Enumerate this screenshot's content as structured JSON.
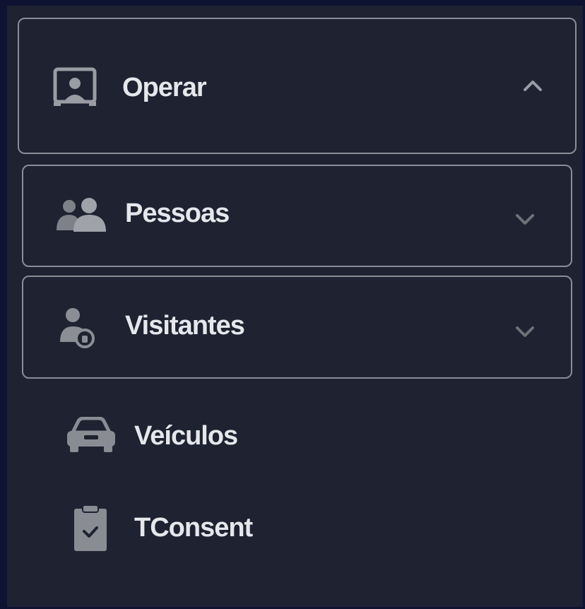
{
  "menu": {
    "items": [
      {
        "label": "Operar",
        "icon": "operator-monitor-icon",
        "expandable": true,
        "expanded": true,
        "chevron": "chevron-up-icon"
      },
      {
        "label": "Pessoas",
        "icon": "people-icon",
        "expandable": true,
        "expanded": false,
        "chevron": "chevron-down-icon"
      },
      {
        "label": "Visitantes",
        "icon": "visitor-icon",
        "expandable": true,
        "expanded": false,
        "chevron": "chevron-down-icon"
      },
      {
        "label": "Veículos",
        "icon": "car-icon",
        "expandable": false
      },
      {
        "label": "TConsent",
        "icon": "clipboard-check-icon",
        "expandable": false
      }
    ]
  },
  "colors": {
    "background": "#1e2231",
    "outer_background": "#0d1330",
    "border": "#8a8d96",
    "text": "#e6e7ea",
    "icon": "#9a9ca3"
  }
}
